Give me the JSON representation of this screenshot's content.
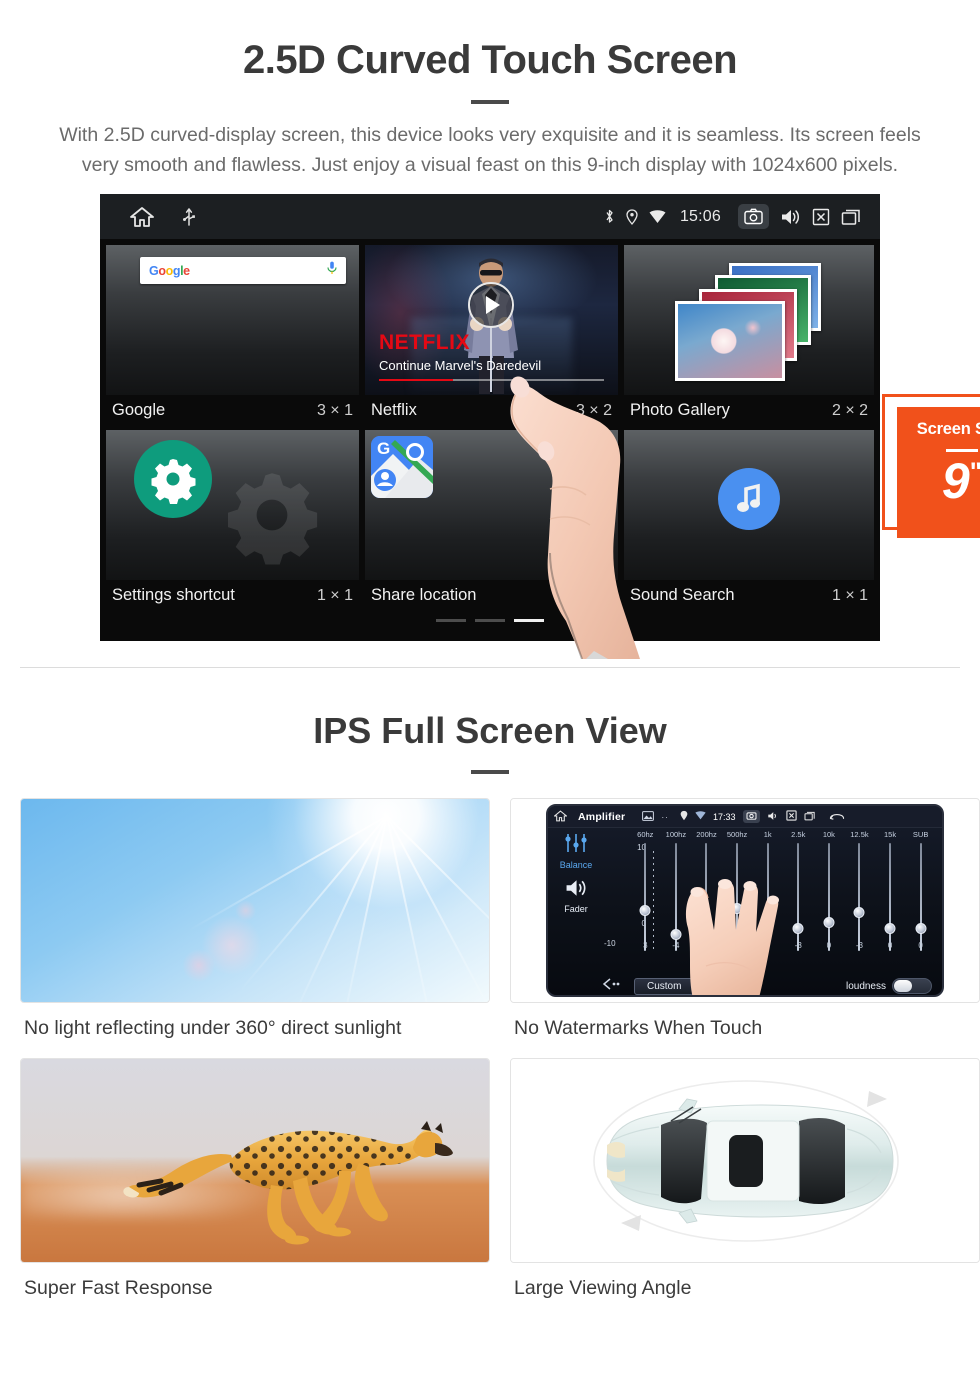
{
  "section_one": {
    "title": "2.5D Curved Touch Screen",
    "paragraph": "With 2.5D curved-display screen, this device looks very exquisite and it is seamless. Its screen feels very smooth and flawless. Just enjoy a visual feast on this 9-inch display with 1024x600 pixels.",
    "badge": {
      "label": "Screen Size",
      "value": "9",
      "unit": "\"",
      "color": "#f1511b"
    },
    "device_screen": {
      "statusbar": {
        "left_icons": [
          "home-icon",
          "usb-icon"
        ],
        "right_icons": [
          "bluetooth-icon",
          "location-icon",
          "wifi-icon"
        ],
        "time": "15:06",
        "trailing_icons": [
          "camera-icon",
          "volume-icon",
          "close-box-icon",
          "recents-icon"
        ]
      },
      "widgets": [
        {
          "name": "Google",
          "size": "3 × 1",
          "icon": "google-search-widget",
          "search_placeholder": "Google"
        },
        {
          "name": "Netflix",
          "size": "3 × 2",
          "icon": "netflix-widget",
          "netflix": {
            "brand": "NETFLIX",
            "subtitle": "Continue Marvel's Daredevil",
            "progress_pct": 33
          }
        },
        {
          "name": "Photo Gallery",
          "size": "2 × 2",
          "icon": "photo-gallery-widget"
        },
        {
          "name": "Settings shortcut",
          "size": "1 × 1",
          "icon": "settings-gear-widget"
        },
        {
          "name": "Share location",
          "size": "1 × 1",
          "icon": "google-maps-widget"
        },
        {
          "name": "Sound Search",
          "size": "1 × 1",
          "icon": "sound-search-widget"
        }
      ],
      "page_indicator": {
        "count": 3,
        "active_index": 2
      }
    }
  },
  "section_two": {
    "title": "IPS Full Screen View",
    "cards": [
      {
        "caption": "No light reflecting under 360° direct sunlight",
        "image": "blue-sky-with-sun-flare"
      },
      {
        "caption": "No Watermarks When Touch",
        "image": "amplifier-equalizer-screenshot"
      },
      {
        "caption": "Super Fast Response",
        "image": "running-cheetah-on-sand"
      },
      {
        "caption": "Large Viewing Angle",
        "image": "car-top-view-with-orbit-arrows"
      }
    ],
    "amplifier": {
      "title": "Amplifier",
      "time": "17:33",
      "side_controls": [
        "Balance",
        "Fader"
      ],
      "bands": [
        "60hz",
        "100hz",
        "200hz",
        "500hz",
        "1k",
        "2.5k",
        "10k",
        "12.5k",
        "15k",
        "SUB"
      ],
      "values": [
        "3",
        "-4",
        "0",
        "0",
        "0",
        "-3",
        "0",
        "-3",
        "0",
        "0"
      ],
      "axis_top": "10",
      "axis_mid": "0",
      "axis_bottom": "-10",
      "preset_button": "Custom",
      "loudness_label": "loudness",
      "loudness_on": false
    }
  }
}
